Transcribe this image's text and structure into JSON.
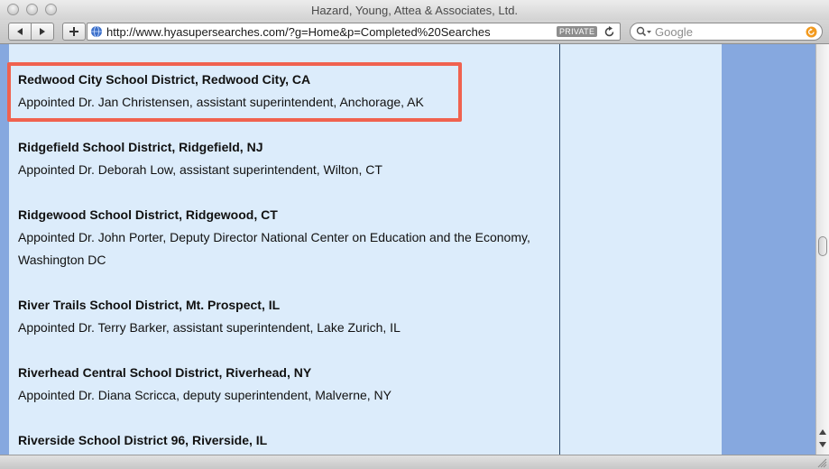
{
  "window": {
    "title": "Hazard, Young, Attea & Associates, Ltd."
  },
  "toolbar": {
    "url": "http://www.hyasupersearches.com/?g=Home&p=Completed%20Searches",
    "private_label": "PRIVATE",
    "search_placeholder": "Google"
  },
  "entries": [
    {
      "name": "Redwood City School District, Redwood City, CA",
      "desc": "Appointed Dr. Jan Christensen, assistant superintendent, Anchorage, AK"
    },
    {
      "name": "Ridgefield School District, Ridgefield, NJ",
      "desc": "Appointed Dr. Deborah Low, assistant superintendent, Wilton, CT"
    },
    {
      "name": "Ridgewood School District, Ridgewood, CT",
      "desc": "Appointed Dr. John Porter, Deputy Director National Center on Education and the Economy, Washington DC"
    },
    {
      "name": "River Trails School District, Mt. Prospect, IL",
      "desc": "Appointed Dr. Terry Barker, assistant superintendent, Lake Zurich, IL"
    },
    {
      "name": "Riverhead Central School District, Riverhead, NY",
      "desc": "Appointed Dr. Diana Scricca, deputy superintendent, Malverne, NY"
    },
    {
      "name": "Riverside School District 96, Riverside, IL",
      "desc": ""
    }
  ],
  "colors": {
    "content_bg": "#dcecfb",
    "sidebar_blue": "#86a8df",
    "highlight_border": "#f0624f"
  }
}
